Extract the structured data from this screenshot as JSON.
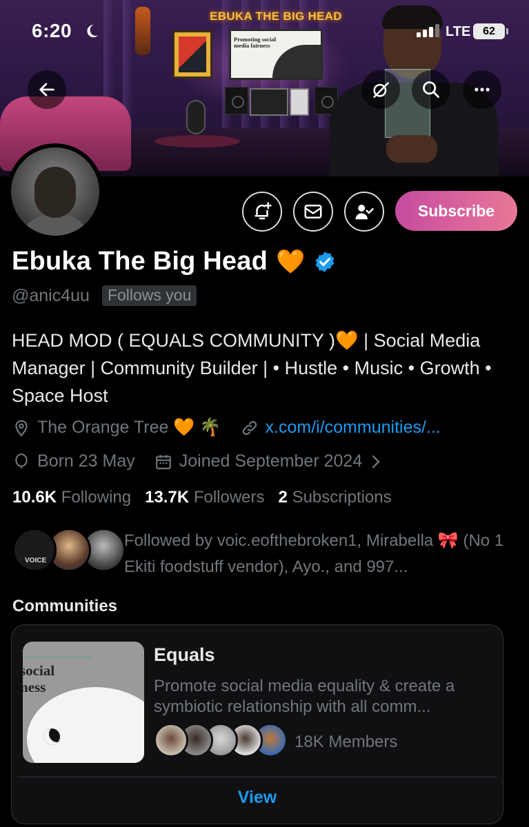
{
  "status_bar": {
    "time": "6:20",
    "network": "LTE",
    "battery": "62"
  },
  "banner": {
    "brand_text": "EBUKA THE BIG HEAD",
    "poster_title": "Promoting social media fairness"
  },
  "header_actions": [
    "back-arrow-icon",
    "grok-icon",
    "search-icon",
    "more-icon"
  ],
  "profile_actions": {
    "buttons": [
      "bell-plus-icon",
      "mail-icon",
      "person-check-icon"
    ],
    "subscribe_label": "Subscribe"
  },
  "profile": {
    "display_name": "Ebuka The Big Head",
    "name_emoji": "🧡",
    "verified": true,
    "handle": "@anic4uu",
    "follows_you": "Follows you",
    "bio": "HEAD MOD ( EQUALS COMMUNITY )🧡 | Social Media Manager | Community Builder | • Hustle • Music • Growth • Space Host",
    "location": "The Orange Tree 🧡 🌴",
    "website": "x.com/i/communities/...",
    "birthday": "Born 23 May",
    "joined": "Joined September 2024"
  },
  "stats": {
    "following_count": "10.6K",
    "following_label": "Following",
    "followers_count": "13.7K",
    "followers_label": "Followers",
    "subscriptions_count": "2",
    "subscriptions_label": "Subscriptions"
  },
  "followed_by": {
    "avatar_badge": "VOICE",
    "text": "Followed by voic.eofthebroken1, Mirabella 🎀 (No 1 Ekiti foodstuff vendor), Ayo., and 997..."
  },
  "communities": {
    "section_title": "Communities",
    "items": [
      {
        "thumb_text": "social\nness",
        "name": "Equals",
        "description": "Promote social media equality & create a symbiotic relationship with all comm...",
        "members": "18K Members",
        "view_label": "View"
      }
    ]
  },
  "colors": {
    "accent": "#1d9bf0",
    "subscribe_start": "#c64b9f",
    "subscribe_end": "#e87898",
    "verified": "#1d9bf0"
  }
}
